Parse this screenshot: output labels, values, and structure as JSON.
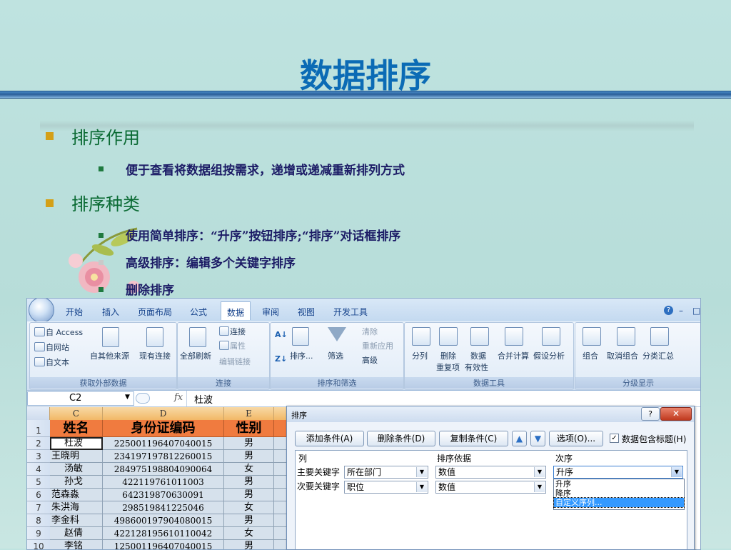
{
  "slide": {
    "title": "数据排序",
    "bullets": [
      {
        "text": "排序作用",
        "sub": [
          "便于查看将数据组按需求，递增或递减重新排列方式"
        ]
      },
      {
        "text": "排序种类",
        "sub": [
          "使用简单排序：“升序”按钮排序;“排序”对话框排序",
          "高级排序：编辑多个关键字排序",
          "删除排序"
        ]
      }
    ]
  },
  "excel": {
    "tabs": [
      "开始",
      "插入",
      "页面布局",
      "公式",
      "数据",
      "审阅",
      "视图",
      "开发工具"
    ],
    "active_tab": "数据",
    "window_controls": [
      "?",
      "–",
      "□"
    ],
    "groups": {
      "external": {
        "label": "获取外部数据",
        "items": [
          "自 Access",
          "自网站",
          "自文本",
          "自其他来源",
          "现有连接"
        ]
      },
      "connections": {
        "label": "连接",
        "items": [
          "全部刷新",
          "连接",
          "属性",
          "编辑链接"
        ]
      },
      "sort_filter": {
        "label": "排序和筛选",
        "items": [
          "排序...",
          "筛选",
          "清除",
          "重新应用",
          "高级"
        ]
      },
      "data_tools": {
        "label": "数据工具",
        "items": [
          "分列",
          "删除",
          "重复项",
          "数据",
          "有效性",
          "合并计算",
          "假设分析"
        ]
      },
      "outline": {
        "label": "分级显示",
        "items": [
          "组合",
          "取消组合",
          "分类汇总"
        ]
      }
    },
    "name_box": "C2",
    "fx": "fx",
    "formula_value": "杜波",
    "columns": [
      "C",
      "D",
      "E"
    ],
    "header_row": [
      "姓名",
      "身份证编码",
      "性别"
    ],
    "rows": [
      [
        "2",
        "杜波",
        "225001196407040015",
        "男"
      ],
      [
        "3",
        "王晓明",
        "234197197812260015",
        "男"
      ],
      [
        "4",
        "汤敏",
        "284975198804090064",
        "女"
      ],
      [
        "5",
        "孙戈",
        "422119761011003",
        "男"
      ],
      [
        "6",
        "范森淼",
        "642319870630091",
        "男"
      ],
      [
        "7",
        "朱洪海",
        "298519841225046",
        "女"
      ],
      [
        "8",
        "李金科",
        "498600197904080015",
        "男"
      ],
      [
        "9",
        "赵倩",
        "422128195610110042",
        "女"
      ],
      [
        "10",
        "李铭",
        "125001196407040015",
        "男"
      ]
    ],
    "row1": "1"
  },
  "sort_dialog": {
    "title": "排序",
    "buttons": {
      "add": "添加条件(A)",
      "delete": "删除条件(D)",
      "copy": "复制条件(C)",
      "options": "选项(O)...",
      "has_header": "数据包含标题(H)"
    },
    "headers": {
      "col": "列",
      "basis": "排序依据",
      "order": "次序"
    },
    "rows": [
      {
        "label": "主要关键字",
        "col": "所在部门",
        "basis": "数值",
        "order": "升序"
      },
      {
        "label": "次要关键字",
        "col": "职位",
        "basis": "数值"
      }
    ],
    "order_options": [
      "升序",
      "降序",
      "自定义序列..."
    ],
    "selected_option_index": 2
  }
}
